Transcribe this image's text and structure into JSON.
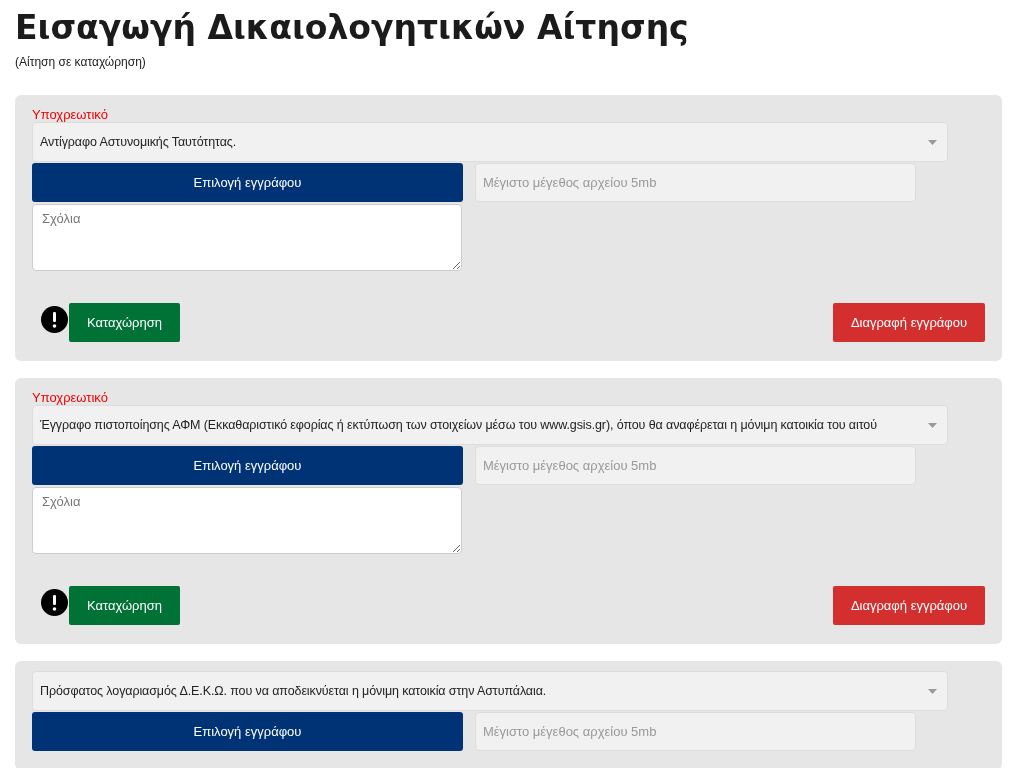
{
  "title": "Εισαγωγή Δικαιολογητικών Αίτησης",
  "subtitle": "(Αίτηση σε καταχώρηση)",
  "documents": [
    {
      "required_label": "Υποχρεωτικό",
      "document_type": "Αντίγραφο Αστυνομικής Ταυτότητας.",
      "choose_button": "Επιλογή εγγράφου",
      "file_placeholder": "Μέγιστο μέγεθος αρχείου 5mb",
      "comments_placeholder": "Σχόλια",
      "submit_button": "Καταχώρηση",
      "delete_button": "Διαγραφή εγγράφου"
    },
    {
      "required_label": "Υποχρεωτικό",
      "document_type": "Έγγραφο πιστοποίησης ΑΦΜ (Εκκαθαριστικό εφορίας ή εκτύπωση των στοιχείων μέσω του www.gsis.gr), όπου θα αναφέρεται η μόνιμη κατοικία του αιτού",
      "choose_button": "Επιλογή εγγράφου",
      "file_placeholder": "Μέγιστο μέγεθος αρχείου 5mb",
      "comments_placeholder": "Σχόλια",
      "submit_button": "Καταχώρηση",
      "delete_button": "Διαγραφή εγγράφου"
    },
    {
      "document_type": "Πρόσφατος λογαριασμός Δ.Ε.Κ.Ω. που να αποδεικνύεται η μόνιμη κατοικία στην Αστυπάλαια.",
      "choose_button": "Επιλογή εγγράφου",
      "file_placeholder": "Μέγιστο μέγεθος αρχείου 5mb"
    }
  ]
}
